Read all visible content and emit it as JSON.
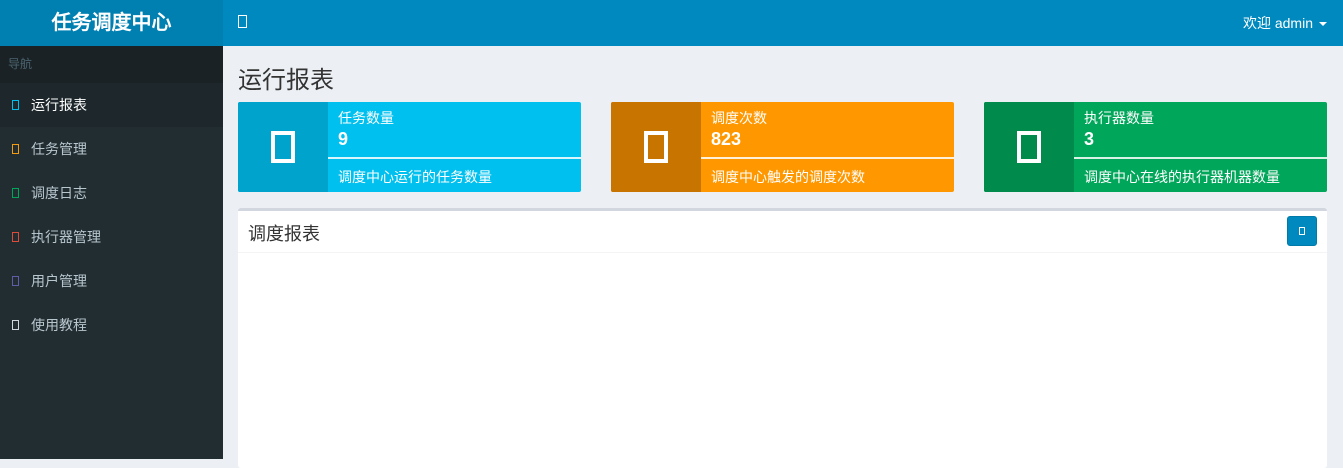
{
  "header": {
    "logo": "任务调度中心",
    "user": "欢迎 admin",
    "toggle_icon": "bars-icon",
    "color": "#0089be",
    "logo_color": "#007fb1"
  },
  "sidebar": {
    "nav_header": "导航",
    "items": [
      {
        "label": "运行报表",
        "icon": "circle-icon",
        "icon_color": "#00c0ef",
        "active": true
      },
      {
        "label": "任务管理",
        "icon": "circle-icon",
        "icon_color": "#f39c12",
        "active": false
      },
      {
        "label": "调度日志",
        "icon": "circle-icon",
        "icon_color": "#00a65a",
        "active": false
      },
      {
        "label": "执行器管理",
        "icon": "circle-icon",
        "icon_color": "#dd4b39",
        "active": false
      },
      {
        "label": "用户管理",
        "icon": "circle-icon",
        "icon_color": "#605ca8",
        "active": false
      },
      {
        "label": "使用教程",
        "icon": "circle-icon",
        "icon_color": "#d2d6de",
        "active": false
      }
    ]
  },
  "main": {
    "page_title": "运行报表",
    "info_boxes": [
      {
        "label": "任务数量",
        "number": "9",
        "desc": "调度中心运行的任务数量",
        "icon": "flag-icon",
        "icon_bg": "#00a3cb",
        "bg": "#00c0ef"
      },
      {
        "label": "调度次数",
        "number": "823",
        "desc": "调度中心触发的调度次数",
        "icon": "calendar-icon",
        "icon_bg": "#c87400",
        "bg": "#ff9800"
      },
      {
        "label": "执行器数量",
        "number": "3",
        "desc": "调度中心在线的执行器机器数量",
        "icon": "server-icon",
        "icon_bg": "#008a4b",
        "bg": "#00a65a"
      }
    ],
    "report_box": {
      "title": "调度报表",
      "tool_icon": "calendar-icon"
    }
  }
}
